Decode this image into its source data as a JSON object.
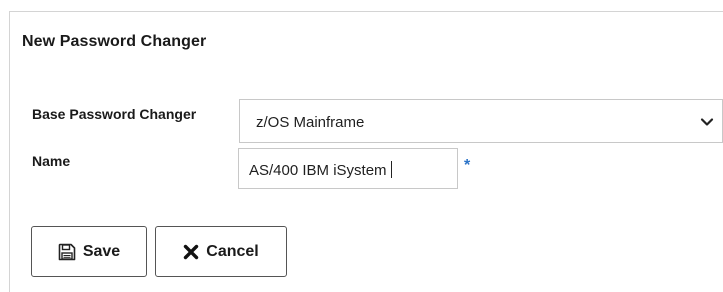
{
  "form": {
    "title": "New Password Changer",
    "base_label": "Base Password Changer",
    "base_value": "z/OS Mainframe",
    "name_label": "Name",
    "name_value": "AS/400 IBM iSystem",
    "required_marker": "*"
  },
  "buttons": {
    "save_label": "Save",
    "save_icon": "floppy-disk-icon",
    "cancel_label": "Cancel",
    "cancel_icon": "x-mark-icon"
  },
  "colors": {
    "required": "#2b73c7",
    "border": "#c8c8c8",
    "button_border": "#555555"
  }
}
